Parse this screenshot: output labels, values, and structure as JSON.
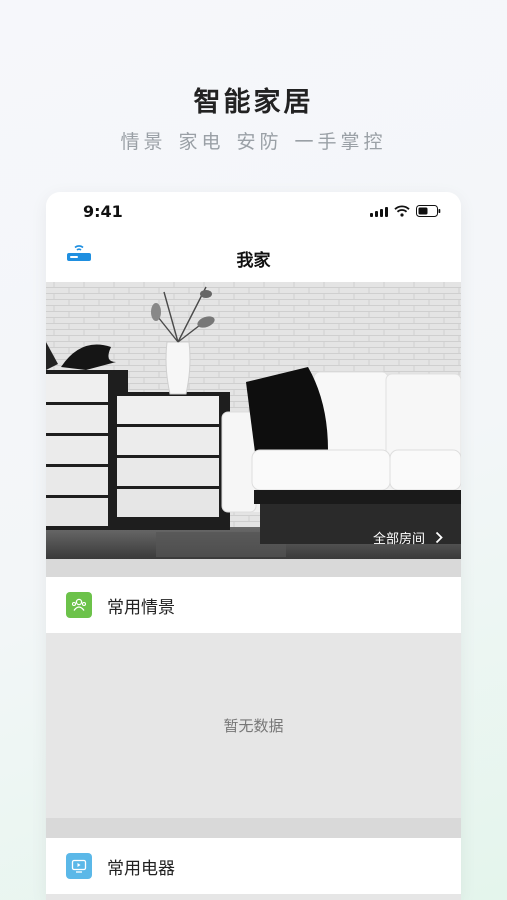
{
  "promo": {
    "title": "智能家居",
    "subtitle": "情景 家电 安防 一手掌控"
  },
  "status_bar": {
    "time": "9:41"
  },
  "nav": {
    "title": "我家",
    "left_icon": "router-icon"
  },
  "banner": {
    "all_rooms_label": "全部房间"
  },
  "sections": [
    {
      "label": "常用情景",
      "icon": "scene-icon",
      "icon_color": "#6cc24a",
      "empty_text": "暂无数据"
    },
    {
      "label": "常用电器",
      "icon": "appliance-icon",
      "icon_color": "#5bb8e8"
    }
  ],
  "colors": {
    "accent_blue": "#1f8fe0",
    "scene_green": "#6cc24a",
    "appliance_blue": "#5bb8e8"
  }
}
